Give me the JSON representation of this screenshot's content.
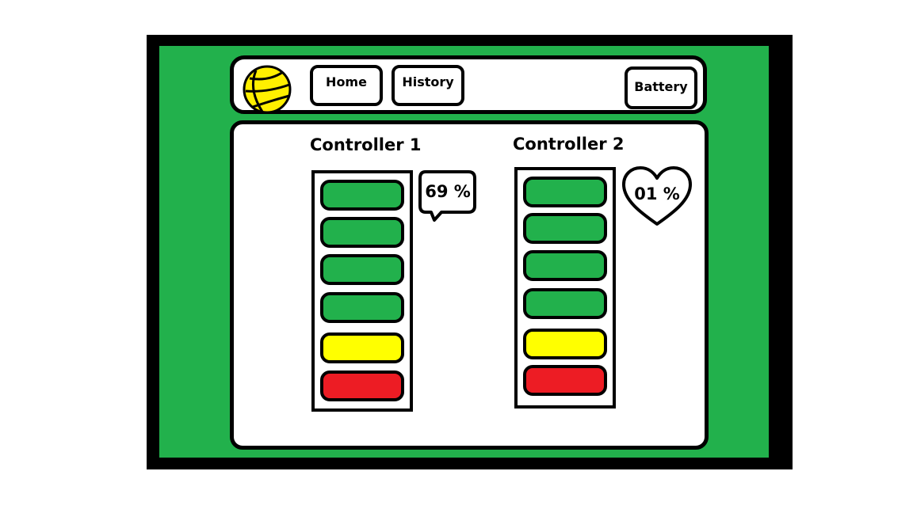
{
  "nav": {
    "logo_icon": "basketball-icon",
    "home_label": "Home",
    "history_label": "History",
    "battery_label": "Battery"
  },
  "colors": {
    "background": "#22b14c",
    "frame": "#000000",
    "segment_green": "#22b14c",
    "segment_yellow": "#ffff00",
    "segment_red": "#ed1c24",
    "logo_yellow": "#ffef00"
  },
  "controllers": [
    {
      "title": "Controller 1",
      "percent_label": "69 %",
      "badge_icon": "speech-bubble-icon",
      "segments": [
        "green",
        "green",
        "green",
        "green",
        "yellow",
        "red"
      ]
    },
    {
      "title": "Controller 2",
      "percent_label": "01 %",
      "badge_icon": "heart-icon",
      "segments": [
        "green",
        "green",
        "green",
        "green",
        "yellow",
        "red"
      ]
    }
  ]
}
